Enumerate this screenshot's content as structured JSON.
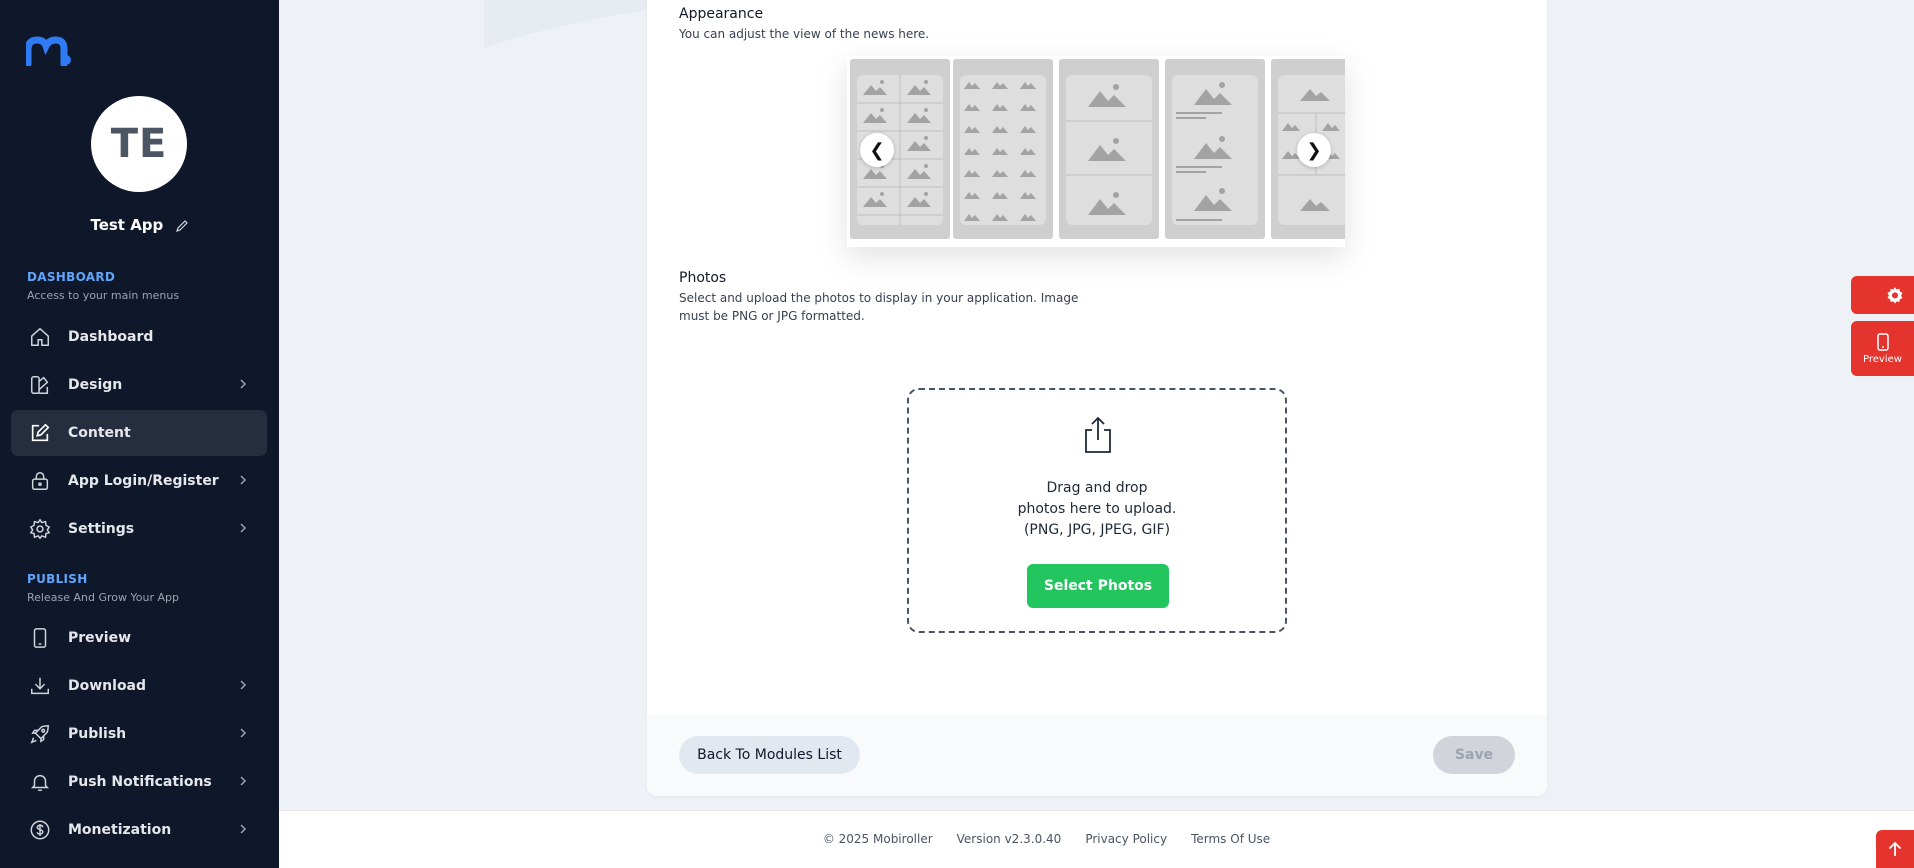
{
  "sidebar": {
    "avatar_initials": "TE",
    "app_name": "Test App",
    "sections": {
      "dashboard": {
        "title": "DASHBOARD",
        "subtitle": "Access to your main menus"
      },
      "publish": {
        "title": "PUBLISH",
        "subtitle": "Release And Grow Your App"
      }
    },
    "items": {
      "dashboard": "Dashboard",
      "design": "Design",
      "content": "Content",
      "login": "App Login/Register",
      "settings": "Settings",
      "preview": "Preview",
      "download": "Download",
      "publish": "Publish",
      "push": "Push Notifications",
      "monetization": "Monetization"
    },
    "active_item": "Content"
  },
  "appearance": {
    "title": "Appearance",
    "description": "You can adjust the view of the news here.",
    "prev_label": "❮",
    "next_label": "❯"
  },
  "photos": {
    "title": "Photos",
    "description_line1": "Select and upload the photos to display in your application. Image",
    "description_line2": "must be PNG or JPG formatted.",
    "drop_line1": "Drag and drop",
    "drop_line2": "photos here to upload.",
    "drop_line3": "(PNG, JPG, JPEG, GIF)",
    "select_button": "Select Photos"
  },
  "actions": {
    "back": "Back To Modules List",
    "save": "Save"
  },
  "footer": {
    "copyright": "© 2025 Mobiroller",
    "version": "Version v2.3.0.40",
    "privacy": "Privacy Policy",
    "terms": "Terms Of Use"
  },
  "floating": {
    "preview_label": "Preview"
  },
  "colors": {
    "sidebar_bg": "#0f172a",
    "accent_blue": "#60a5fa",
    "primary_green": "#22c55e",
    "floating_red": "#e5342e"
  }
}
